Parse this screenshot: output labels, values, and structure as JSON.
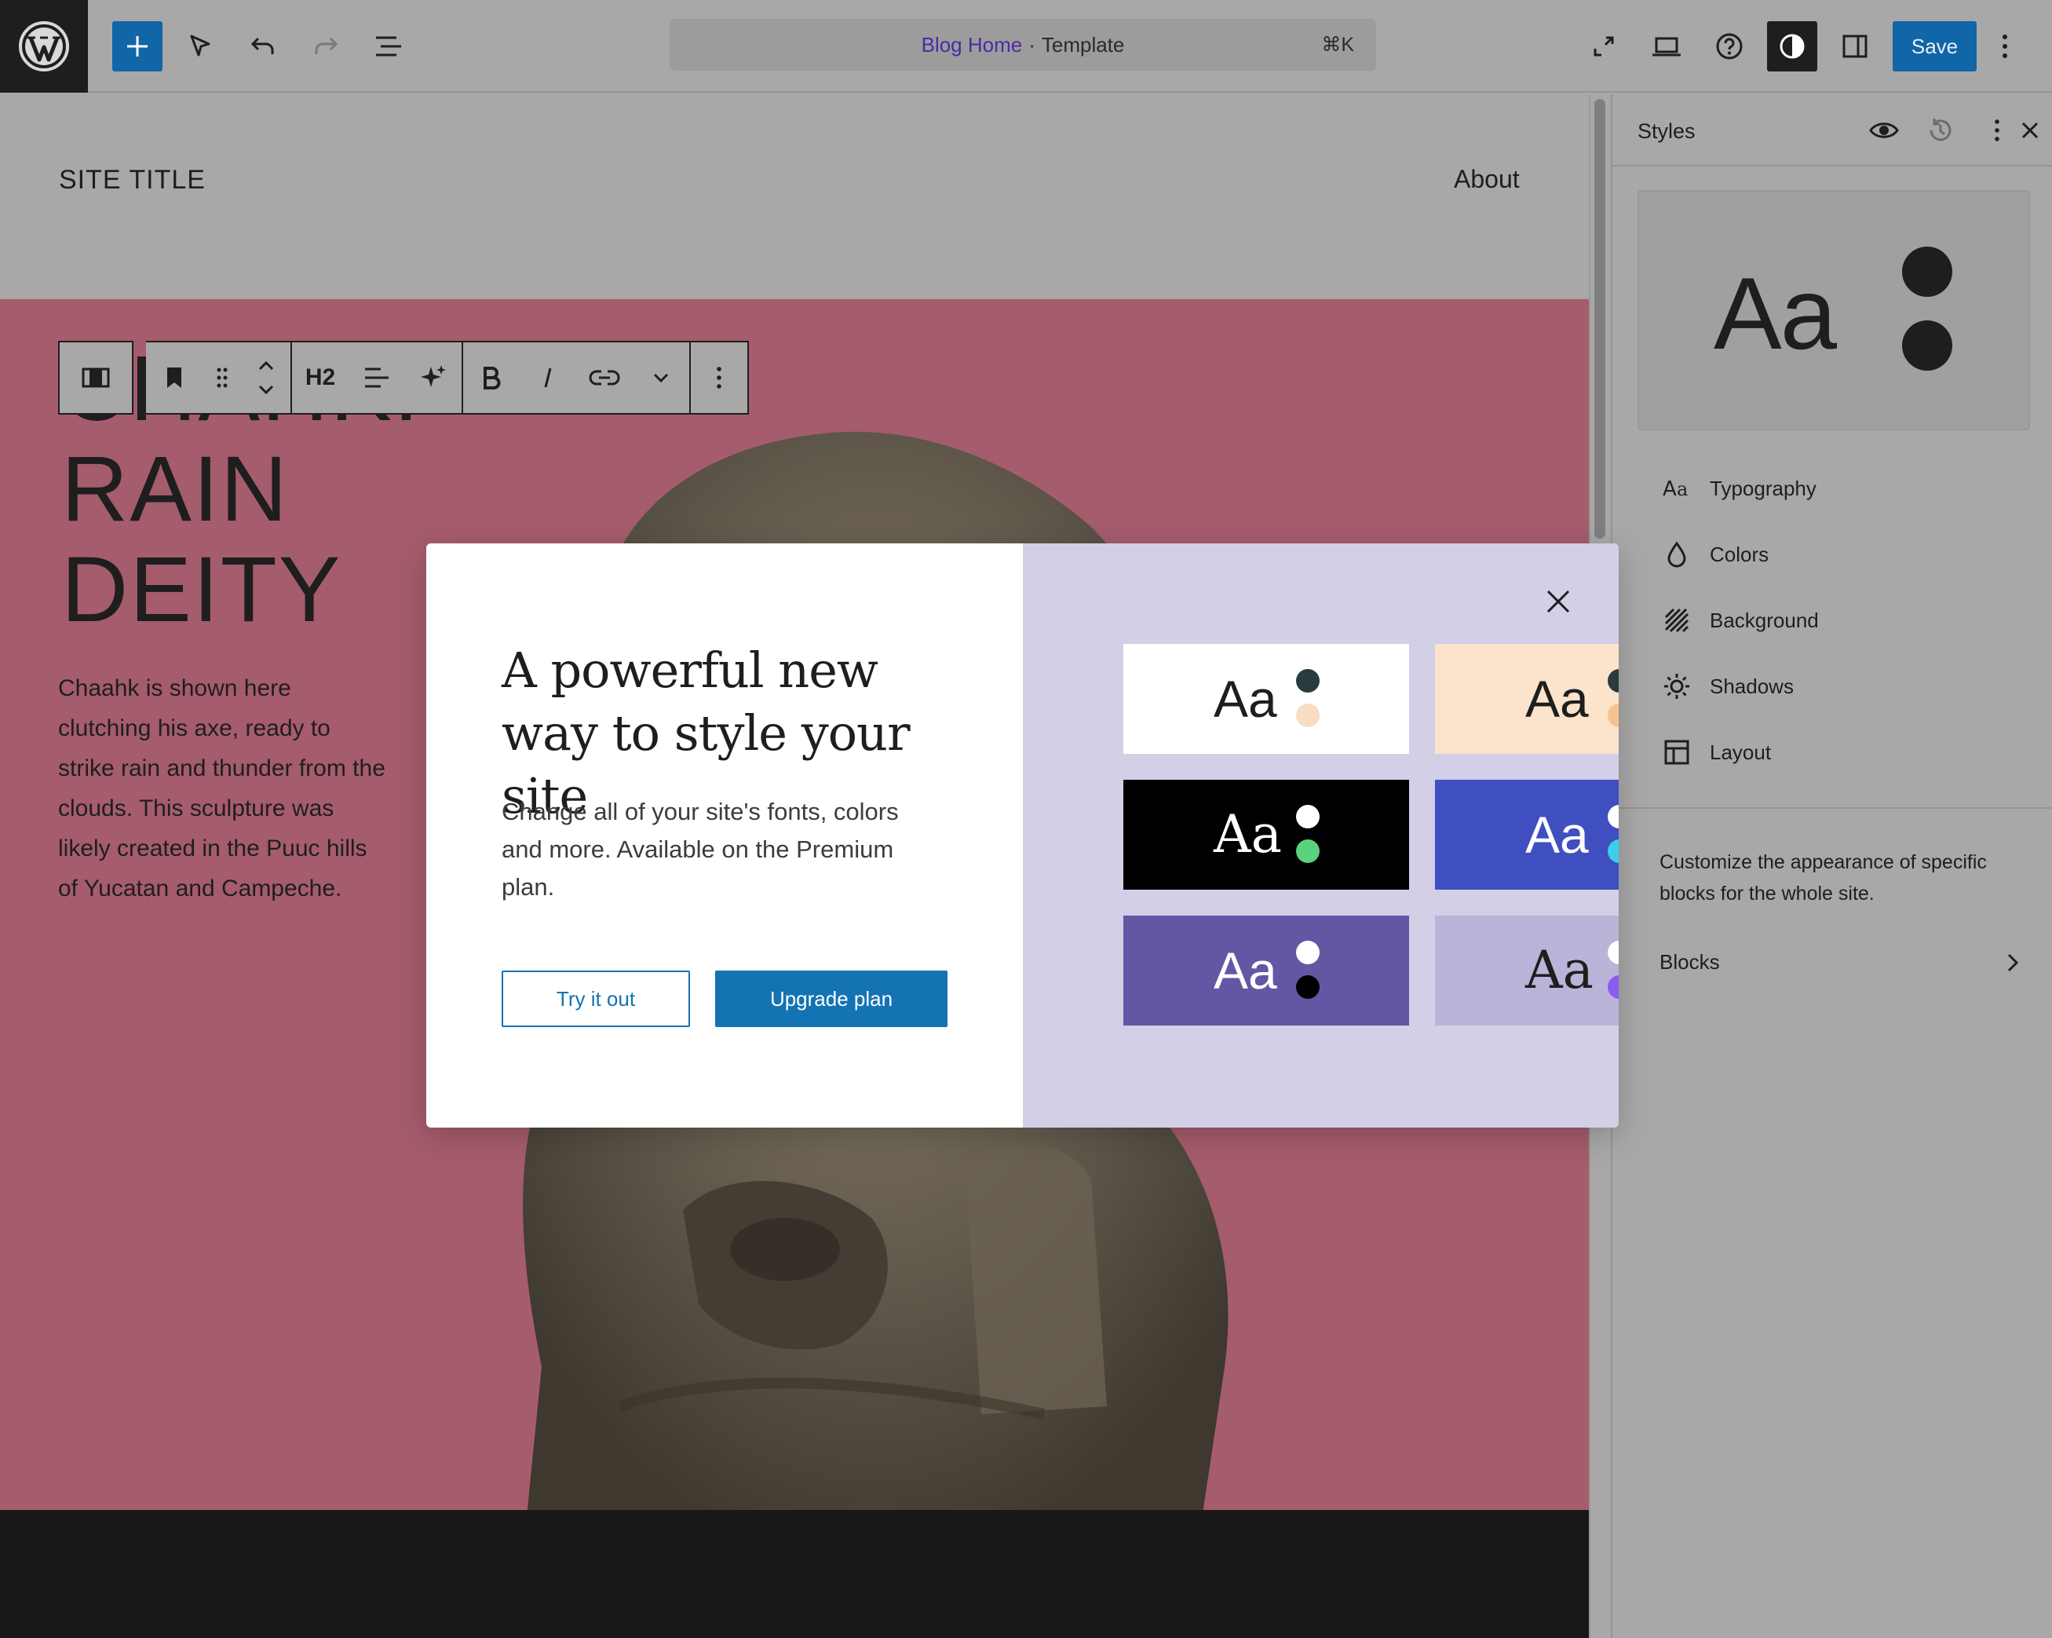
{
  "topbar": {
    "document_title": "Blog Home",
    "document_type": "Template",
    "separator": "·",
    "shortcut": "⌘K",
    "save_label": "Save",
    "accent": "#1166a8"
  },
  "canvas": {
    "site_title": "SITE TITLE",
    "nav_items": [
      "About"
    ],
    "heading_lines": [
      "CHAHK:",
      "RAIN",
      "DEITY"
    ],
    "body_text": "Chaahk is shown here clutching his axe, ready to strike rain and thunder from the clouds. This sculpture was likely created in the Puuc hills of Yucatan and Campeche.",
    "hero_color": "#a55c6d",
    "block_toolbar": {
      "heading_level": "H2"
    }
  },
  "sidebar": {
    "title": "Styles",
    "preview_text": "Aa",
    "items": [
      {
        "label": "Typography",
        "icon": "typography-icon"
      },
      {
        "label": "Colors",
        "icon": "droplet-icon"
      },
      {
        "label": "Background",
        "icon": "background-icon"
      },
      {
        "label": "Shadows",
        "icon": "shadow-icon"
      },
      {
        "label": "Layout",
        "icon": "layout-icon"
      }
    ],
    "description": "Customize the appearance of specific blocks for the whole site.",
    "blocks_label": "Blocks"
  },
  "modal": {
    "title": "A powerful new way to style your site",
    "description": "Change all of your site's fonts, colors and more. Available on the Premium plan.",
    "try_label": "Try it out",
    "upgrade_label": "Upgrade plan",
    "variations": [
      {
        "text": "Aa",
        "bg": "#ffffff",
        "fg": "#1e1e1e",
        "dot1": "#2a3b3d",
        "dot2": "#f9dcc4",
        "serif": false
      },
      {
        "text": "Aa",
        "bg": "#fbe3cc",
        "fg": "#1e1e1e",
        "dot1": "#2a3b3d",
        "dot2": "#f6c38f",
        "serif": false
      },
      {
        "text": "Aa",
        "bg": "#000000",
        "fg": "#ffffff",
        "dot1": "#ffffff",
        "dot2": "#5ad17b",
        "serif": true
      },
      {
        "text": "Aa",
        "bg": "#3f4fc0",
        "fg": "#ffffff",
        "dot1": "#ffffff",
        "dot2": "#39d0e8",
        "serif": false
      },
      {
        "text": "Aa",
        "bg": "#6556a4",
        "fg": "#ffffff",
        "dot1": "#ffffff",
        "dot2": "#000000",
        "serif": false
      },
      {
        "text": "Aa",
        "bg": "#b9b4d8",
        "fg": "#1e1e1e",
        "dot1": "#ffffff",
        "dot2": "#8a5cf0",
        "serif": true
      }
    ]
  }
}
